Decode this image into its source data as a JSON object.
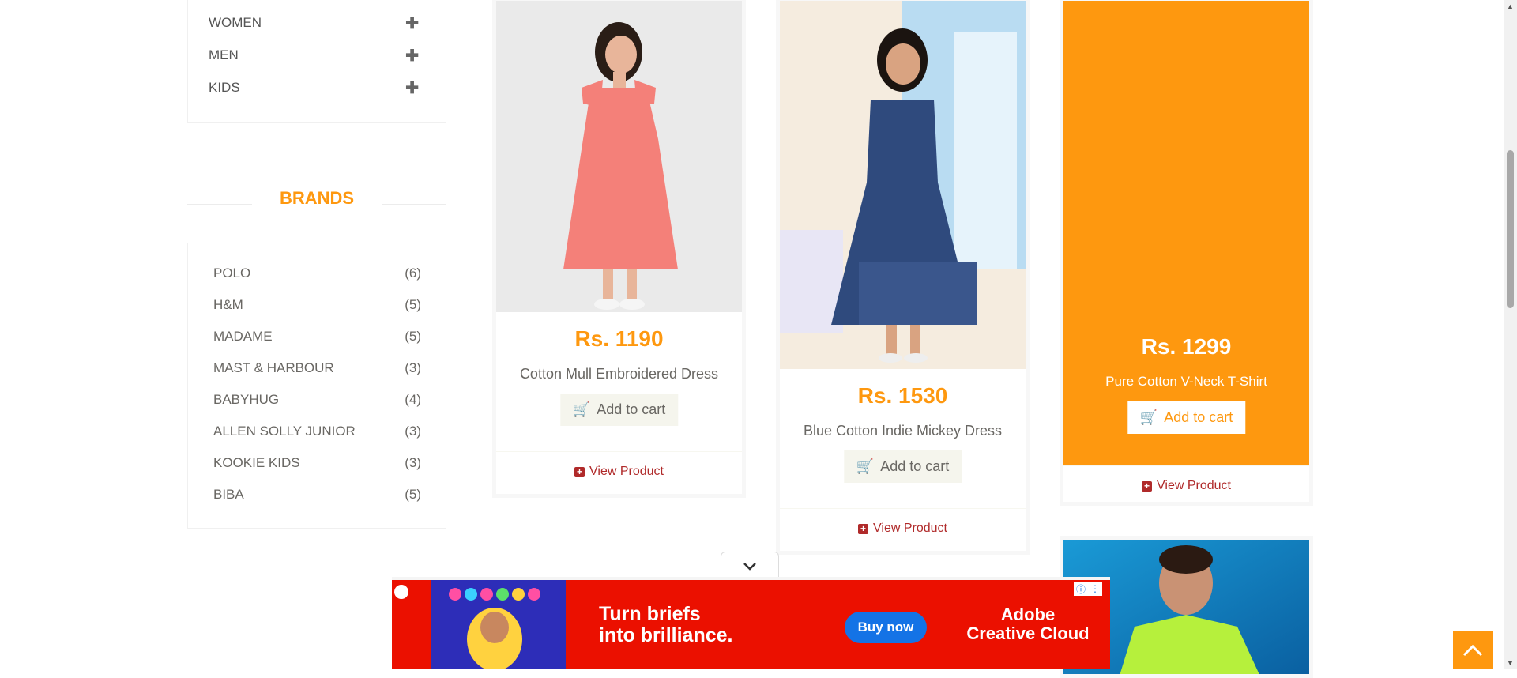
{
  "categories": [
    {
      "label": "WOMEN",
      "icon": "plus-icon"
    },
    {
      "label": "MEN",
      "icon": "plus-icon"
    },
    {
      "label": "KIDS",
      "icon": "plus-icon"
    }
  ],
  "brands": {
    "heading": "BRANDS",
    "items": [
      {
        "name": "POLO",
        "count": "(6)"
      },
      {
        "name": "H&M",
        "count": "(5)"
      },
      {
        "name": "MADAME",
        "count": "(5)"
      },
      {
        "name": "MAST & HARBOUR",
        "count": "(3)"
      },
      {
        "name": "BABYHUG",
        "count": "(4)"
      },
      {
        "name": "ALLEN SOLLY JUNIOR",
        "count": "(3)"
      },
      {
        "name": "KOOKIE KIDS",
        "count": "(3)"
      },
      {
        "name": "BIBA",
        "count": "(5)"
      }
    ]
  },
  "products": [
    {
      "price": "Rs. 1190",
      "name": "Cotton Mull Embroidered Dress",
      "cart": "Add to cart",
      "view": "View Product"
    },
    {
      "price": "Rs. 1530",
      "name": "Blue Cotton Indie Mickey Dress",
      "cart": "Add to cart",
      "view": "View Product"
    },
    {
      "price": "Rs. 1299",
      "name": "Pure Cotton V-Neck T-Shirt",
      "cart": "Add to cart",
      "view": "View Product"
    }
  ],
  "ad": {
    "headline_1": "Turn briefs",
    "headline_2": "into brilliance.",
    "cta": "Buy now",
    "brand_1": "Adobe",
    "brand_2": "Creative Cloud"
  },
  "colors": {
    "accent": "#fe980f",
    "link": "#b02a2a",
    "ad_bg": "#eb1000",
    "ad_button": "#1473e6"
  }
}
